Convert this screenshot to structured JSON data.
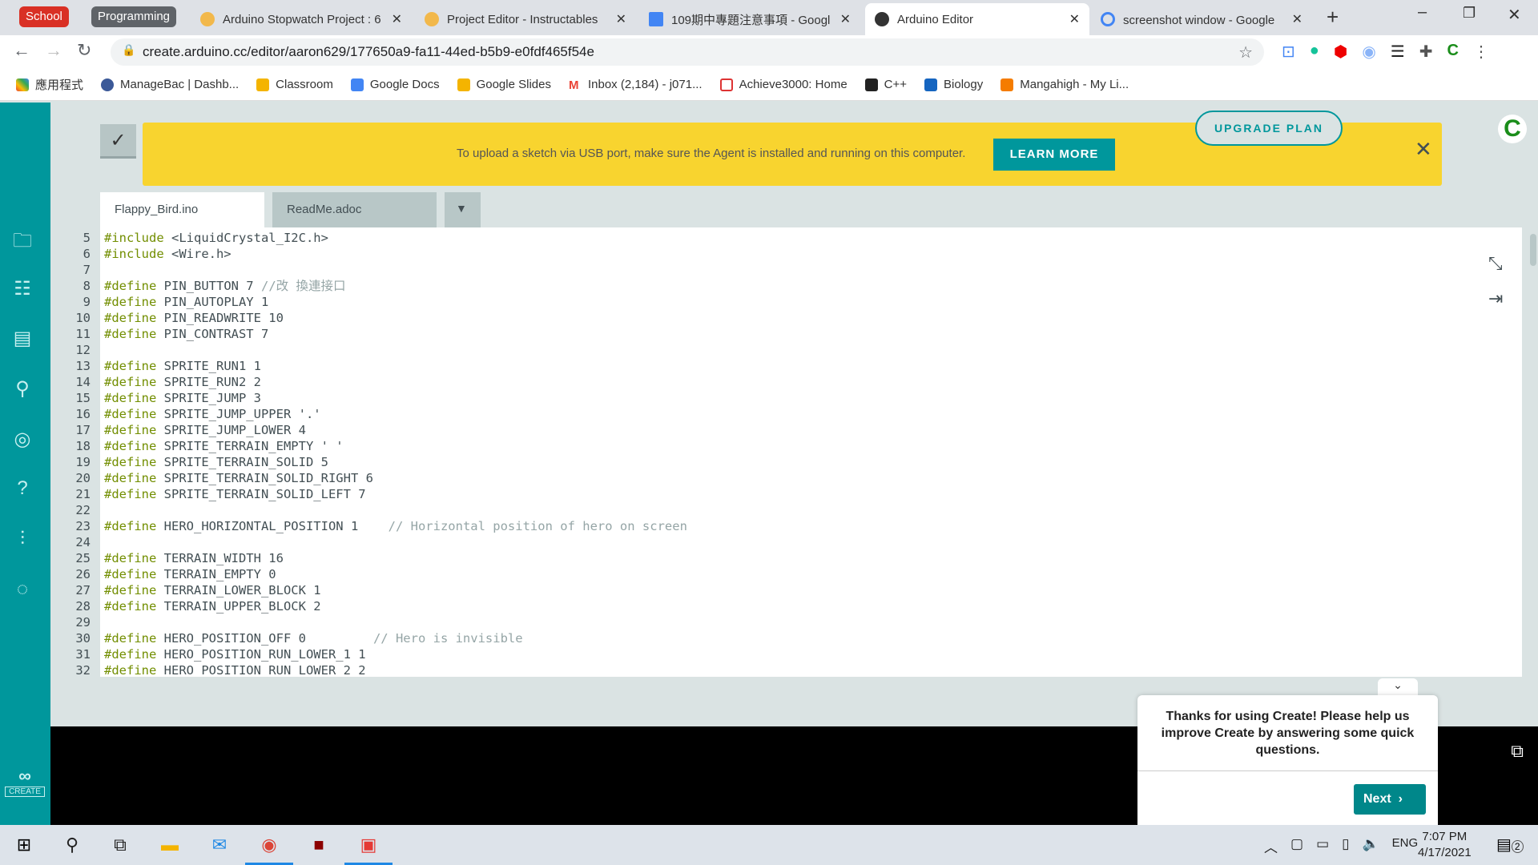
{
  "browser": {
    "groups": [
      {
        "label": "School",
        "color": "#d93025"
      },
      {
        "label": "Programming",
        "color": "#5f6368"
      }
    ],
    "tabs": [
      {
        "title": "Arduino Stopwatch Project : 6"
      },
      {
        "title": "Project Editor - Instructables"
      },
      {
        "title": "109期中專題注意事項 - Googl"
      },
      {
        "title": "Arduino Editor",
        "active": true
      },
      {
        "title": "screenshot window - Google 搜"
      }
    ],
    "url": "create.arduino.cc/editor/aaron629/177650a9-fa11-44ed-b5b9-e0fdf465f54e",
    "bookmarks": [
      "應用程式",
      "ManageBac | Dashb...",
      "Classroom",
      "Google Docs",
      "Google Slides",
      "Inbox (2,184) - j071...",
      "Achieve3000: Home",
      "C++",
      "Biology",
      "Mangahigh - My Li..."
    ]
  },
  "banner": {
    "text": "To upload a sketch via USB port, make sure the Agent is installed and running on this computer.",
    "learn_more": "LEARN MORE"
  },
  "upgrade": "UPGRADE PLAN",
  "user_initial": "C",
  "file_tabs": [
    "Flappy_Bird.ino",
    "ReadMe.adoc"
  ],
  "code": [
    {
      "n": "5",
      "kw": "#include",
      "tx": " <LiquidCrystal_I2C.h>",
      "cm": ""
    },
    {
      "n": "6",
      "kw": "#include",
      "tx": " <Wire.h>",
      "cm": ""
    },
    {
      "n": "7",
      "kw": "",
      "tx": "",
      "cm": ""
    },
    {
      "n": "8",
      "kw": "#define",
      "tx": " PIN_BUTTON 7 ",
      "cm": "//改 換連接口"
    },
    {
      "n": "9",
      "kw": "#define",
      "tx": " PIN_AUTOPLAY 1",
      "cm": ""
    },
    {
      "n": "10",
      "kw": "#define",
      "tx": " PIN_READWRITE 10",
      "cm": ""
    },
    {
      "n": "11",
      "kw": "#define",
      "tx": " PIN_CONTRAST 7",
      "cm": ""
    },
    {
      "n": "12",
      "kw": "",
      "tx": "",
      "cm": ""
    },
    {
      "n": "13",
      "kw": "#define",
      "tx": " SPRITE_RUN1 1",
      "cm": ""
    },
    {
      "n": "14",
      "kw": "#define",
      "tx": " SPRITE_RUN2 2",
      "cm": ""
    },
    {
      "n": "15",
      "kw": "#define",
      "tx": " SPRITE_JUMP 3",
      "cm": ""
    },
    {
      "n": "16",
      "kw": "#define",
      "tx": " SPRITE_JUMP_UPPER '.'",
      "cm": ""
    },
    {
      "n": "17",
      "kw": "#define",
      "tx": " SPRITE_JUMP_LOWER 4",
      "cm": ""
    },
    {
      "n": "18",
      "kw": "#define",
      "tx": " SPRITE_TERRAIN_EMPTY ' '",
      "cm": ""
    },
    {
      "n": "19",
      "kw": "#define",
      "tx": " SPRITE_TERRAIN_SOLID 5",
      "cm": ""
    },
    {
      "n": "20",
      "kw": "#define",
      "tx": " SPRITE_TERRAIN_SOLID_RIGHT 6",
      "cm": ""
    },
    {
      "n": "21",
      "kw": "#define",
      "tx": " SPRITE_TERRAIN_SOLID_LEFT 7",
      "cm": ""
    },
    {
      "n": "22",
      "kw": "",
      "tx": "",
      "cm": ""
    },
    {
      "n": "23",
      "kw": "#define",
      "tx": " HERO_HORIZONTAL_POSITION 1    ",
      "cm": "// Horizontal position of hero on screen"
    },
    {
      "n": "24",
      "kw": "",
      "tx": "",
      "cm": ""
    },
    {
      "n": "25",
      "kw": "#define",
      "tx": " TERRAIN_WIDTH 16",
      "cm": ""
    },
    {
      "n": "26",
      "kw": "#define",
      "tx": " TERRAIN_EMPTY 0",
      "cm": ""
    },
    {
      "n": "27",
      "kw": "#define",
      "tx": " TERRAIN_LOWER_BLOCK 1",
      "cm": ""
    },
    {
      "n": "28",
      "kw": "#define",
      "tx": " TERRAIN_UPPER_BLOCK 2",
      "cm": ""
    },
    {
      "n": "29",
      "kw": "",
      "tx": "",
      "cm": ""
    },
    {
      "n": "30",
      "kw": "#define",
      "tx": " HERO_POSITION_OFF 0         ",
      "cm": "// Hero is invisible"
    },
    {
      "n": "31",
      "kw": "#define",
      "tx": " HERO_POSITION_RUN_LOWER_1 1",
      "cm": ""
    },
    {
      "n": "32",
      "kw": "#define",
      "tx": " HERO_POSITION_RUN_LOWER_2 2",
      "cm": ""
    }
  ],
  "survey": {
    "text": "Thanks for using Create! Please help us improve Create by answering some quick questions.",
    "next": "Next"
  },
  "logo_text": "CREATE",
  "taskbar": {
    "lang": "ENG",
    "time": "7:07 PM",
    "date": "4/17/2021",
    "notifications": "2"
  },
  "colors": {
    "accent": "#00979c",
    "banner": "#f8d42f",
    "keyword": "#728e00",
    "comment": "#95a5a6"
  }
}
